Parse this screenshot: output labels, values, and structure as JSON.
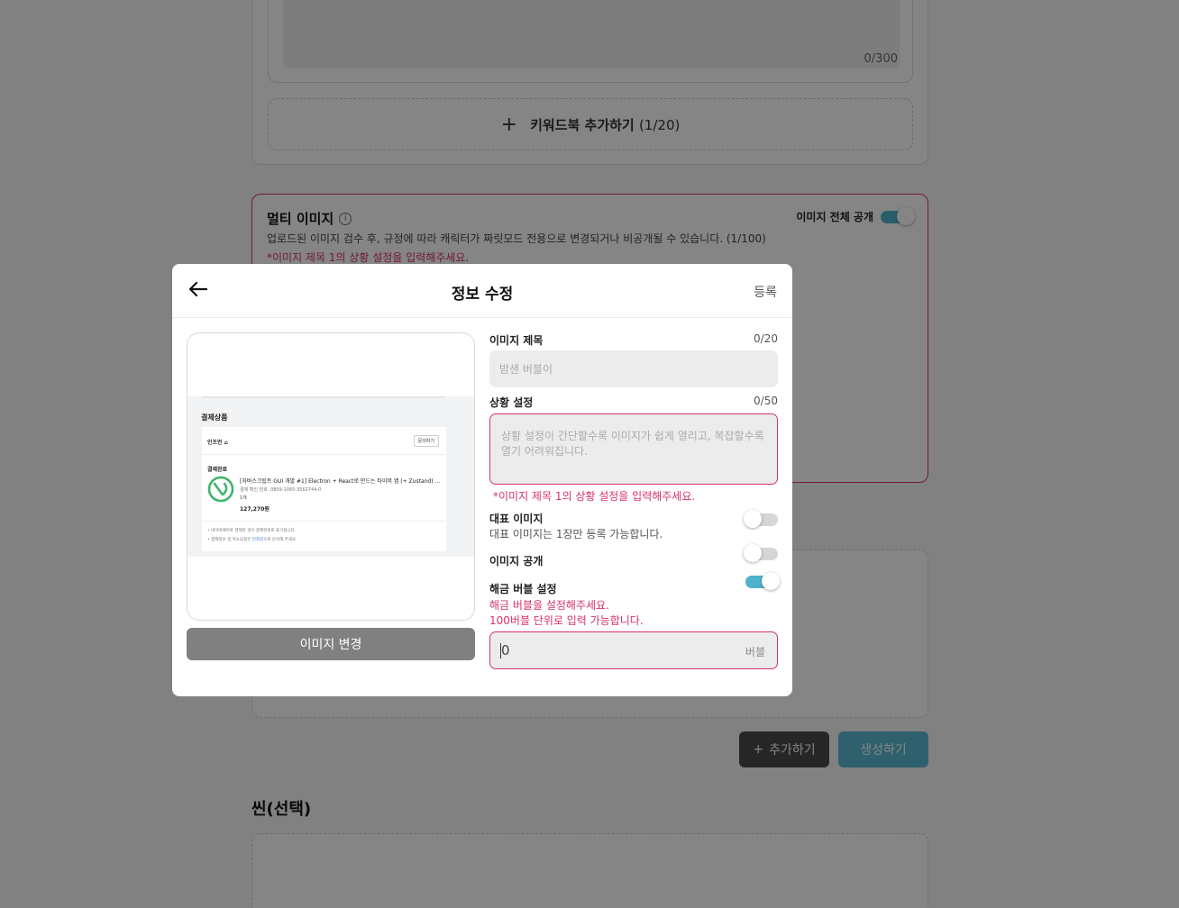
{
  "background": {
    "keyword_textarea_count": "0/300",
    "keyword_add_label": "키워드북 추가하기",
    "keyword_add_count": "(1/20)",
    "multi_image": {
      "title": "멀티 이미지",
      "description": "업로드된 이미지 검수 후, 규정에 따라 캐릭터가 짜릿모드 전용으로 변경되거나 비공개될 수 있습니다. (1/100)",
      "error": "*이미지 제목 1의 상황 설정을 입력해주세요.",
      "public_all_label": "이미지 전체 공개",
      "public_all_on": true
    },
    "add_button_label": "추가하기",
    "create_button_label": "생성하기",
    "scene_title": "씬(선택)"
  },
  "modal": {
    "title": "정보 수정",
    "submit_label": "등록",
    "change_image_label": "이미지 변경",
    "preview": {
      "heading": "결제상품",
      "brand": "인프런 ⌂",
      "ask_label": "문의하기",
      "done_label": "결제완료",
      "product": "[자바스크립트 GUI 개발 #1] Electron + React로 만드는 타이머 앱 (+ Zustand) ...",
      "order": "결제 확인 번호: 0809-1065-3562744-0",
      "qty": "1개",
      "price": "127,270원",
      "note1": "• 네이버페이로 결제한 경우 결제완료로 표기됩니다.",
      "note2_pre": "• 결제정보 및 취소요청은 ",
      "note2_link": "인프런",
      "note2_post": "으로 문의해 주세요."
    },
    "image_title": {
      "label": "이미지 제목",
      "count": "0/20",
      "placeholder": "밤샌 버블이"
    },
    "situation": {
      "label": "상황 설정",
      "count": "0/50",
      "placeholder": "상황 설정이 간단할수록 이미지가 쉽게 열리고, 복잡할수록 열기 어려워집니다.",
      "error": "*이미지 제목 1의 상황 설정을 입력해주세요."
    },
    "representative": {
      "label": "대표 이미지",
      "description": "대표 이미지는 1장만 등록 가능합니다.",
      "on": false
    },
    "public": {
      "label": "이미지 공개",
      "on": false
    },
    "unlock_bubble": {
      "label": "해금 버블 설정",
      "error1": "해금 버블을 설정해주세요.",
      "error2": "100버블 단위로 입력 가능합니다.",
      "on": true,
      "value": "0",
      "unit": "버블"
    }
  },
  "colors": {
    "accent": "#d8326b",
    "toggle_on": "#4fb2cc",
    "create_button": "#59b9d3"
  }
}
